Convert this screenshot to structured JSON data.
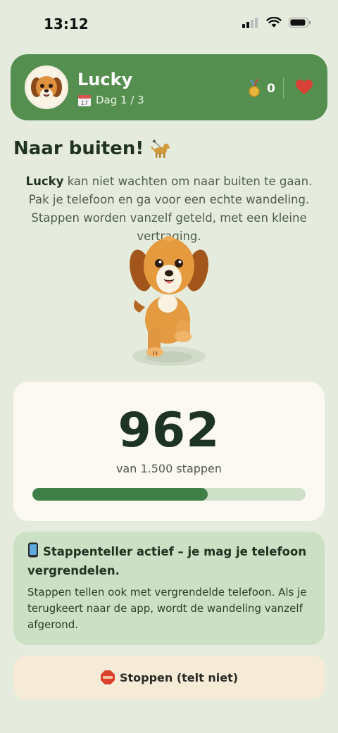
{
  "status_bar": {
    "time": "13:12"
  },
  "header": {
    "pet_name": "Lucky",
    "day_label": "Dag 1 / 3",
    "medal_count": "0",
    "icons": [
      "avatar-dog",
      "calendar-icon",
      "medal-icon",
      "heart-icon"
    ]
  },
  "walk": {
    "title": "Naar buiten!",
    "desc_name": "Lucky",
    "desc_rest": " kan niet wachten om naar buiten te gaan. Pak je telefoon en ga voor een echte wandeling. Stappen worden vanzelf geteld, met een kleine vertraging."
  },
  "steps": {
    "count": "962",
    "goal_label": "van 1.500 stappen",
    "progress": 0.641
  },
  "info": {
    "title": "Stappenteller actief – je mag je telefoon vergrendelen.",
    "body": "Stappen tellen ook met vergrendelde telefoon. Als je terugkeert naar de app, wordt de wandeling vanzelf afgerond."
  },
  "stop": {
    "label": "Stoppen (telt niet)"
  },
  "colors": {
    "accent": "#558f4f",
    "progress": "#3e7f48",
    "background": "#e6ecdd"
  }
}
